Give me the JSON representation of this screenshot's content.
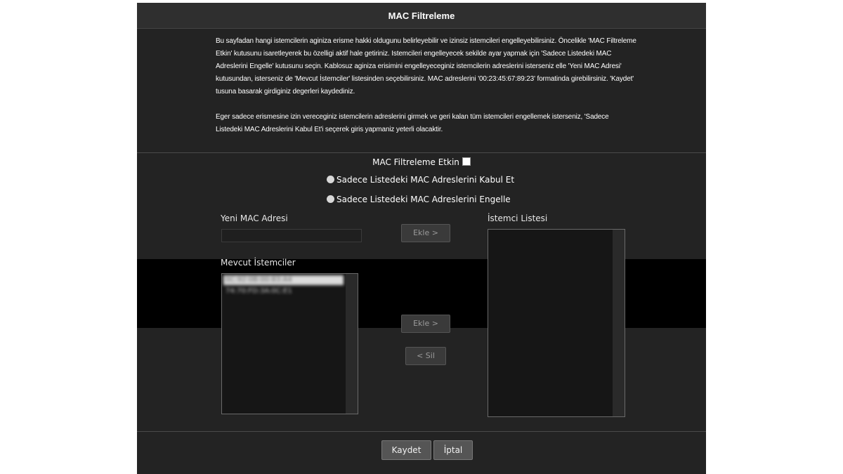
{
  "title": "MAC Filtreleme",
  "description": {
    "paragraph1": "Bu sayfadan hangi istemcilerin aginiza erisme hakki oldugunu belirleyebilir ve izinsiz istemcileri engelleyebilirsiniz. Öncelikle 'MAC Filtreleme Etkin' kutusunu isaretleyerek bu özelligi aktif hale getiriniz. Istemcileri engelleyecek sekilde ayar yapmak için 'Sadece Listedeki MAC Adreslerini Engelle' kutusunu seçin. Kablosuz aginiza erisimini engelleyeceginiz istemcilerin adreslerini isterseniz elle 'Yeni MAC Adresi' kutusundan, isterseniz de 'Mevcut İstemciler' listesinden seçebilirsiniz. MAC adreslerini '00:23:45:67:89:23' formatinda girebilirsiniz. 'Kaydet' tusuna basarak girdiginiz degerleri kaydediniz.",
    "paragraph2": "Eger sadece erismesine izin vereceginiz istemcilerin adreslerini girmek ve geri kalan tüm istemcileri engellemek isterseniz, 'Sadece Listedeki MAC Adreslerini Kabul Et'i seçerek giris yapmaniz yeterli olacaktir."
  },
  "filter_enable": {
    "label": "MAC Filtreleme Etkin",
    "checked": false
  },
  "radios": {
    "accept_label": "Sadece Listedeki MAC Adreslerini Kabul Et",
    "block_label": "Sadece Listedeki MAC Adreslerini Engelle"
  },
  "new_mac": {
    "label": "Yeni MAC Adresi",
    "value": ""
  },
  "existing_clients": {
    "label": "Mevcut İstemciler",
    "items": [
      "0C:92:0B:00:83:A4",
      "74:70:FD:3A:0C:E1"
    ]
  },
  "client_list": {
    "label": "İstemci Listesi"
  },
  "buttons": {
    "add_top": "Ekle >",
    "add_bottom": "Ekle >",
    "remove": "< Sil",
    "save": "Kaydet",
    "cancel": "İptal"
  }
}
